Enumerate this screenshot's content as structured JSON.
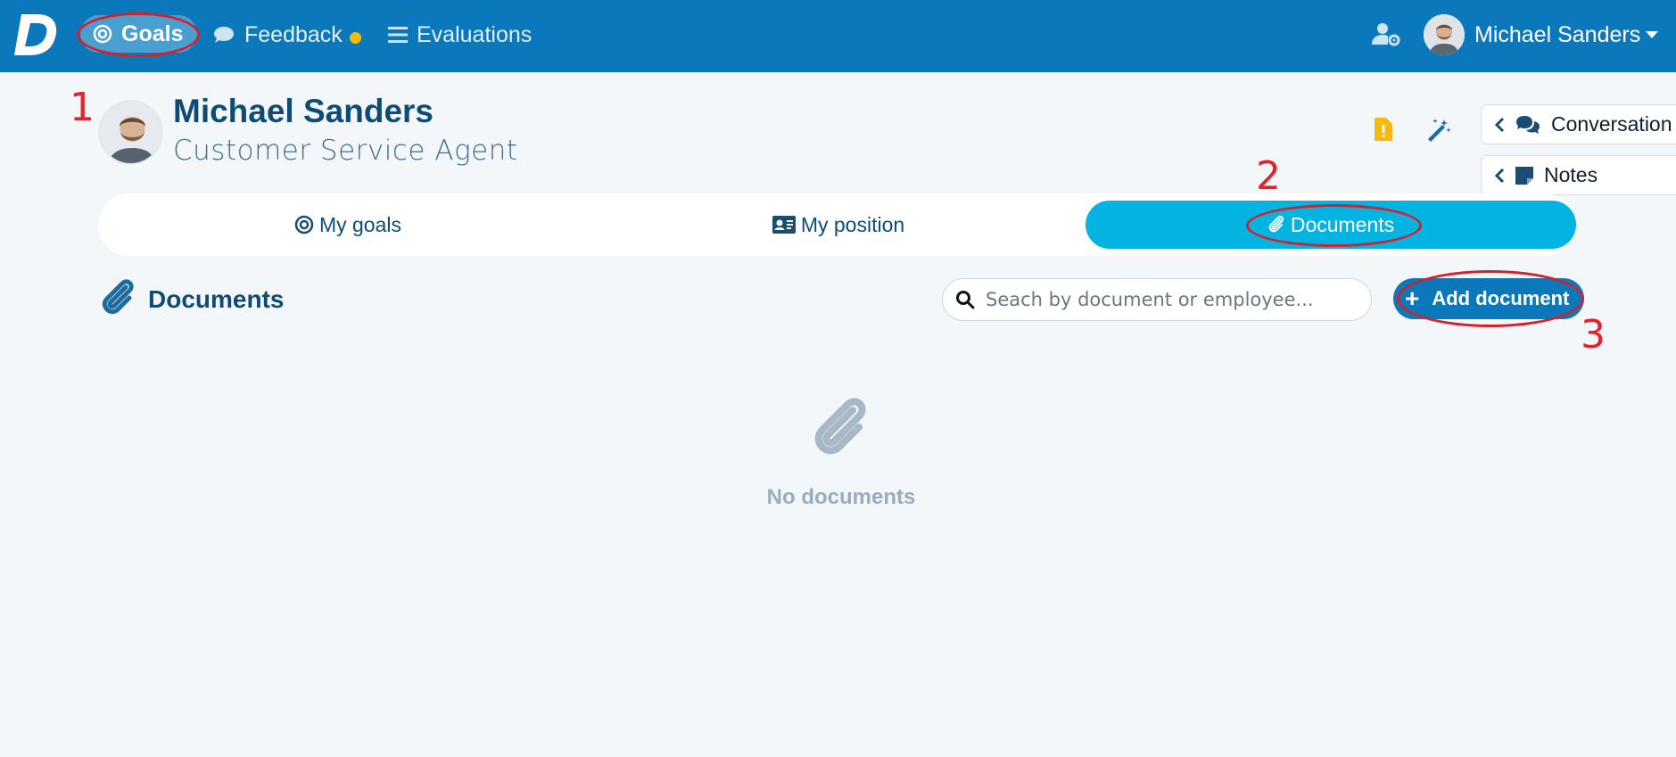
{
  "nav": {
    "goals": "Goals",
    "feedback": "Feedback",
    "evaluations": "Evaluations",
    "user_name": "Michael Sanders"
  },
  "profile": {
    "name": "Michael Sanders",
    "role": "Customer Service Agent"
  },
  "side_panels": {
    "conversation": "Conversation",
    "notes": "Notes"
  },
  "tabs": {
    "my_goals": "My goals",
    "my_position": "My position",
    "documents": "Documents",
    "active": "Documents"
  },
  "documents": {
    "title": "Documents",
    "search_placeholder": "Seach by document or employee...",
    "add_button": "Add document",
    "empty_text": "No documents"
  },
  "annotations": [
    "1",
    "2",
    "3"
  ],
  "colors": {
    "topbar": "#0a78ba",
    "active_tab": "#03b4e2",
    "annotation": "#e8202a",
    "notification_dot": "#f2bd0d"
  }
}
